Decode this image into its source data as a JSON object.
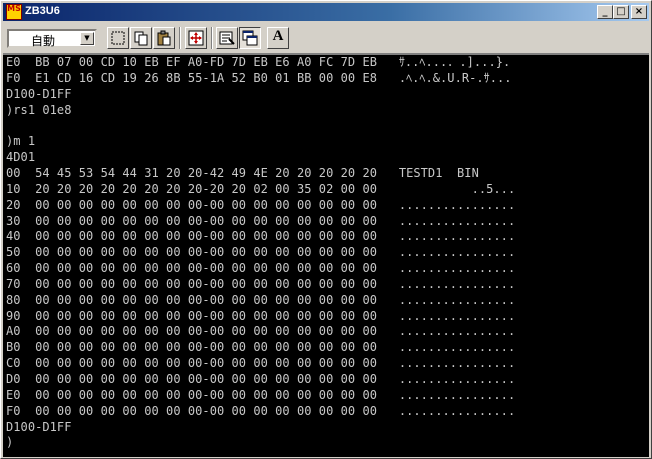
{
  "window": {
    "title": "ZB3U6",
    "app_icon_text": "MS"
  },
  "titlebar_buttons": {
    "minimize": "_",
    "maximize": "□",
    "close": "×"
  },
  "toolbar": {
    "mode_select_value": "自動",
    "tools": [
      "select-region-icon",
      "copy-icon",
      "paste-icon",
      "move-icon",
      "properties-icon",
      "window-mode-icon",
      "font-icon"
    ],
    "font_button_label": "A"
  },
  "terminal": {
    "lines": [
      "E0  BB 07 00 CD 10 EB EF A0-FD 7D EB E6 A0 FC 7D EB   ｻ..ﾍ...．.]...}.",
      "F0  E1 CD 16 CD 19 26 8B 55-1A 52 B0 01 BB 00 00 E8   .ﾍ.ﾍ.&.U.R-.ｻ...",
      "D100-D1FF",
      ")rs1 01e8",
      "",
      ")m 1",
      "4D01",
      "00  54 45 53 54 44 31 20 20-42 49 4E 20 20 20 20 20   TESTD1  BIN",
      "10  20 20 20 20 20 20 20 20-20 20 02 00 35 02 00 00             ..5...",
      "20  00 00 00 00 00 00 00 00-00 00 00 00 00 00 00 00   ................",
      "30  00 00 00 00 00 00 00 00-00 00 00 00 00 00 00 00   ................",
      "40  00 00 00 00 00 00 00 00-00 00 00 00 00 00 00 00   ................",
      "50  00 00 00 00 00 00 00 00-00 00 00 00 00 00 00 00   ................",
      "60  00 00 00 00 00 00 00 00-00 00 00 00 00 00 00 00   ................",
      "70  00 00 00 00 00 00 00 00-00 00 00 00 00 00 00 00   ................",
      "80  00 00 00 00 00 00 00 00-00 00 00 00 00 00 00 00   ................",
      "90  00 00 00 00 00 00 00 00-00 00 00 00 00 00 00 00   ................",
      "A0  00 00 00 00 00 00 00 00-00 00 00 00 00 00 00 00   ................",
      "B0  00 00 00 00 00 00 00 00-00 00 00 00 00 00 00 00   ................",
      "C0  00 00 00 00 00 00 00 00-00 00 00 00 00 00 00 00   ................",
      "D0  00 00 00 00 00 00 00 00-00 00 00 00 00 00 00 00   ................",
      "E0  00 00 00 00 00 00 00 00-00 00 00 00 00 00 00 00   ................",
      "F0  00 00 00 00 00 00 00 00-00 00 00 00 00 00 00 00   ................",
      "D100-D1FF",
      ")"
    ]
  }
}
